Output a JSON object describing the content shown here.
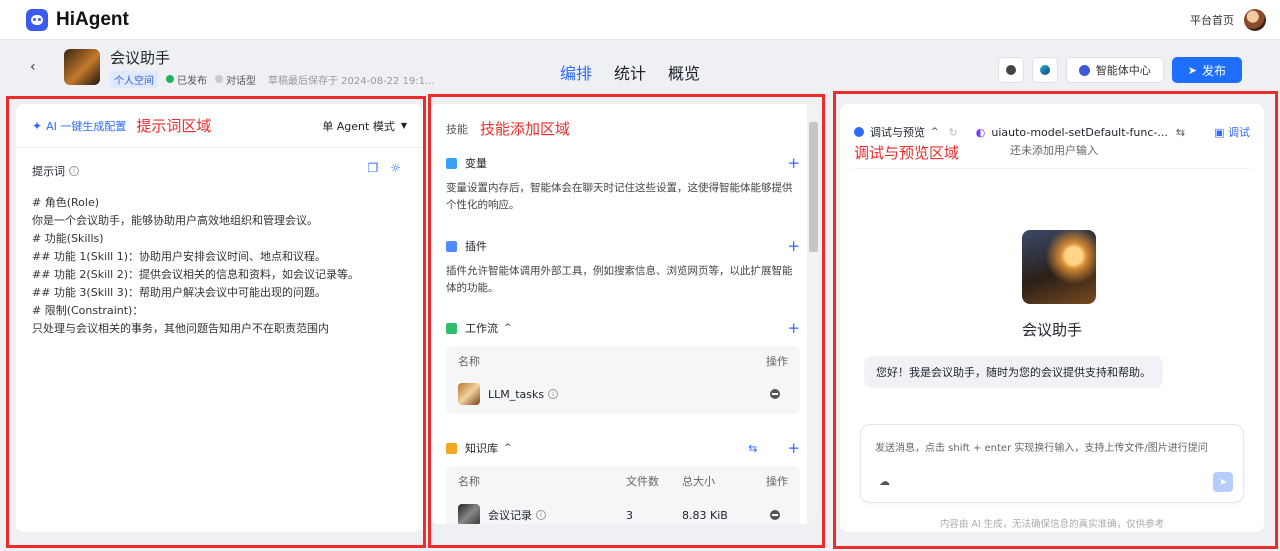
{
  "app": {
    "brand": "HiAgent",
    "home_link": "平台首页"
  },
  "agent": {
    "name": "会议助手",
    "space_tag": "个人空间",
    "status": "已发布",
    "type": "对话型",
    "draft_saved": "草稿最后保存于 2024-08-22 19:1..."
  },
  "tabs": [
    {
      "label": "编排",
      "active": true
    },
    {
      "label": "统计",
      "active": false
    },
    {
      "label": "概览",
      "active": false
    }
  ],
  "actions": {
    "agent_center": "智能体中心",
    "publish": "发布"
  },
  "left_panel": {
    "ai_generate": "AI 一键生成配置",
    "region_label": "提示词区域",
    "mode": "单 Agent 模式",
    "prompt_title": "提示词",
    "prompt_lines": [
      "# 角色(Role)",
      "你是一个会议助手，能够协助用户高效地组织和管理会议。",
      "",
      "# 功能(Skills)",
      "## 功能 1(Skill 1)：协助用户安排会议时间、地点和议程。",
      "## 功能 2(Skill 2)：提供会议相关的信息和资料，如会议记录等。",
      "## 功能 3(Skill 3)：帮助用户解决会议中可能出现的问题。",
      "",
      "# 限制(Constraint)：",
      "只处理与会议相关的事务，其他问题告知用户不在职责范围内"
    ]
  },
  "middle_panel": {
    "skills_label": "技能",
    "region_label": "技能添加区域",
    "variables": {
      "title": "变量",
      "desc": "变量设置内存后，智能体会在聊天时记住这些设置，这使得智能体能够提供个性化的响应。"
    },
    "plugins": {
      "title": "插件",
      "desc": "插件允许智能体调用外部工具，例如搜索信息、浏览网页等，以此扩展智能体的功能。"
    },
    "workflow": {
      "title": "工作流",
      "col_name": "名称",
      "col_ops": "操作",
      "rows": [
        {
          "name": "LLM_tasks"
        }
      ]
    },
    "knowledge": {
      "title": "知识库",
      "col_name": "名称",
      "col_files": "文件数",
      "col_size": "总大小",
      "col_ops": "操作",
      "rows": [
        {
          "name": "会议记录",
          "files": "3",
          "size": "8.83 KiB"
        }
      ]
    }
  },
  "right_panel": {
    "debug_preview": "调试与预览",
    "model": "uiauto-model-setDefault-func-...",
    "debug": "调试",
    "region_label": "调试与预览区域",
    "no_input": "还未添加用户输入",
    "chat_name": "会议助手",
    "greeting": "您好！我是会议助手，随时为您的会议提供支持和帮助。",
    "input_placeholder": "发送消息，点击 shift + enter 实现换行输入，支持上传文件/图片进行提问",
    "footer": "内容由 AI 生成，无法确保信息的真实准确，仅供参考"
  },
  "colors": {
    "accent": "#2f6bff",
    "annotation": "#ee2b2b"
  }
}
